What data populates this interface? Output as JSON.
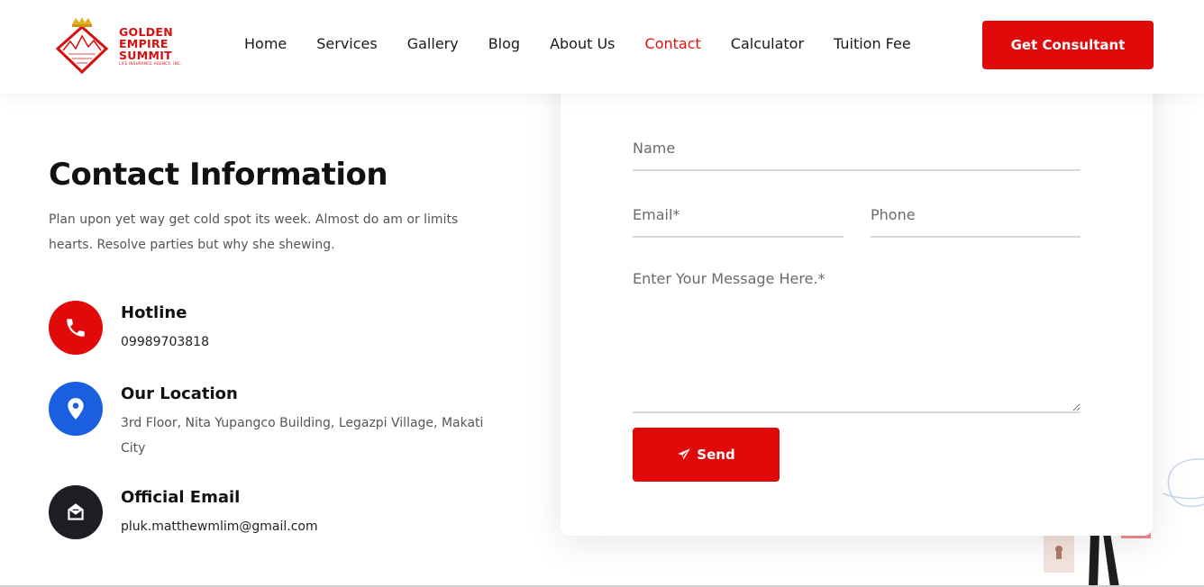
{
  "header": {
    "logo": {
      "line1": "GOLDEN",
      "line2": "EMPIRE",
      "line3": "SUMMIT",
      "tagline": "LIFE INSURANCE AGENCY, INC."
    },
    "nav": [
      {
        "label": "Home",
        "active": false
      },
      {
        "label": "Services",
        "active": false
      },
      {
        "label": "Gallery",
        "active": false
      },
      {
        "label": "Blog",
        "active": false
      },
      {
        "label": "About Us",
        "active": false
      },
      {
        "label": "Contact",
        "active": true
      },
      {
        "label": "Calculator",
        "active": false
      },
      {
        "label": "Tuition Fee",
        "active": false
      }
    ],
    "cta_label": "Get Consultant"
  },
  "contact": {
    "title": "Contact Information",
    "description": "Plan upon yet way get cold spot its week. Almost do am or limits hearts. Resolve parties but why she shewing.",
    "items": [
      {
        "icon": "phone-icon",
        "color": "#e00a0a",
        "title": "Hotline",
        "value": "09989703818"
      },
      {
        "icon": "location-pin-icon",
        "color": "#1a5fe0",
        "title": "Our Location",
        "value": "3rd Floor, Nita Yupangco Building, Legazpi Village, Makati City"
      },
      {
        "icon": "envelope-icon",
        "color": "#1c1e24",
        "title": "Official Email",
        "value": "pluk.matthewmlim@gmail.com"
      }
    ]
  },
  "form": {
    "name_placeholder": "Name",
    "email_placeholder": "Email*",
    "phone_placeholder": "Phone",
    "message_placeholder": "Enter Your Message Here.*",
    "send_label": "Send"
  },
  "colors": {
    "accent": "#e00a0a",
    "nav_active": "#e01212",
    "location_icon_bg": "#1a5fe0",
    "email_icon_bg": "#1c1e24"
  }
}
